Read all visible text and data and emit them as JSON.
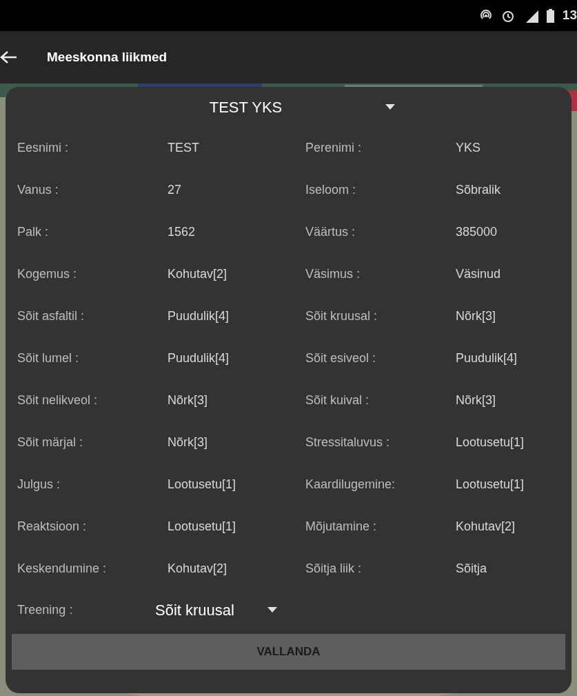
{
  "status_bar": {
    "time": "13"
  },
  "app_bar": {
    "title": "Meeskonna liikmed"
  },
  "dialog": {
    "member_select": {
      "value": "TEST YKS"
    },
    "fields": [
      {
        "label": "Eesnimi :",
        "value": "TEST"
      },
      {
        "label": "Perenimi :",
        "value": "YKS"
      },
      {
        "label": "Vanus :",
        "value": "27"
      },
      {
        "label": "Iseloom :",
        "value": "Sõbralik"
      },
      {
        "label": "Palk :",
        "value": "1562"
      },
      {
        "label": "Väärtus :",
        "value": "385000"
      },
      {
        "label": "Kogemus :",
        "value": "Kohutav[2]"
      },
      {
        "label": "Väsimus :",
        "value": "Väsinud"
      },
      {
        "label": "Sõit asfaltil :",
        "value": "Puudulik[4]"
      },
      {
        "label": "Sõit kruusal :",
        "value": "Nõrk[3]"
      },
      {
        "label": "Sõit lumel :",
        "value": "Puudulik[4]"
      },
      {
        "label": "Sõit esiveol :",
        "value": "Puudulik[4]"
      },
      {
        "label": "Sõit nelikveol :",
        "value": "Nõrk[3]"
      },
      {
        "label": "Sõit kuival :",
        "value": "Nõrk[3]"
      },
      {
        "label": "Sõit märjal :",
        "value": "Nõrk[3]"
      },
      {
        "label": "Stressitaluvus :",
        "value": "Lootusetu[1]"
      },
      {
        "label": "Julgus :",
        "value": "Lootusetu[1]"
      },
      {
        "label": "Kaardilugemine:",
        "value": "Lootusetu[1]"
      },
      {
        "label": "Reaktsioon :",
        "value": "Lootusetu[1]"
      },
      {
        "label": "Mõjutamine :",
        "value": "Kohutav[2]"
      },
      {
        "label": "Keskendumine :",
        "value": "Kohutav[2]"
      },
      {
        "label": "Sõitja liik :",
        "value": "Sõitja"
      }
    ],
    "training": {
      "label": "Treening :",
      "value": "Sõit kruusal"
    },
    "button": "VALLANDA"
  }
}
